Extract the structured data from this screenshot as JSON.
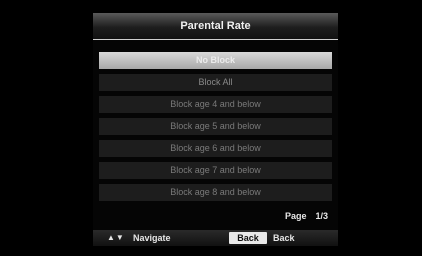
{
  "dialog": {
    "title": "Parental Rate",
    "options": [
      {
        "label": "No Block"
      },
      {
        "label": "Block All"
      },
      {
        "label": "Block age 4 and below"
      },
      {
        "label": "Block age 5 and below"
      },
      {
        "label": "Block age 6 and below"
      },
      {
        "label": "Block age 7 and below"
      },
      {
        "label": "Block age 8 and below"
      }
    ],
    "selected_index": 0,
    "page_label": "Page",
    "page_value": "1/3"
  },
  "footer": {
    "navigate_icon": "up-down-arrows-icon",
    "navigate_label": "Navigate",
    "back_key": "Back",
    "back_label": "Back"
  },
  "colors": {
    "selected_bg": "#c4c4c4",
    "item_bg": "#1d1d1d",
    "background": "#000000"
  }
}
